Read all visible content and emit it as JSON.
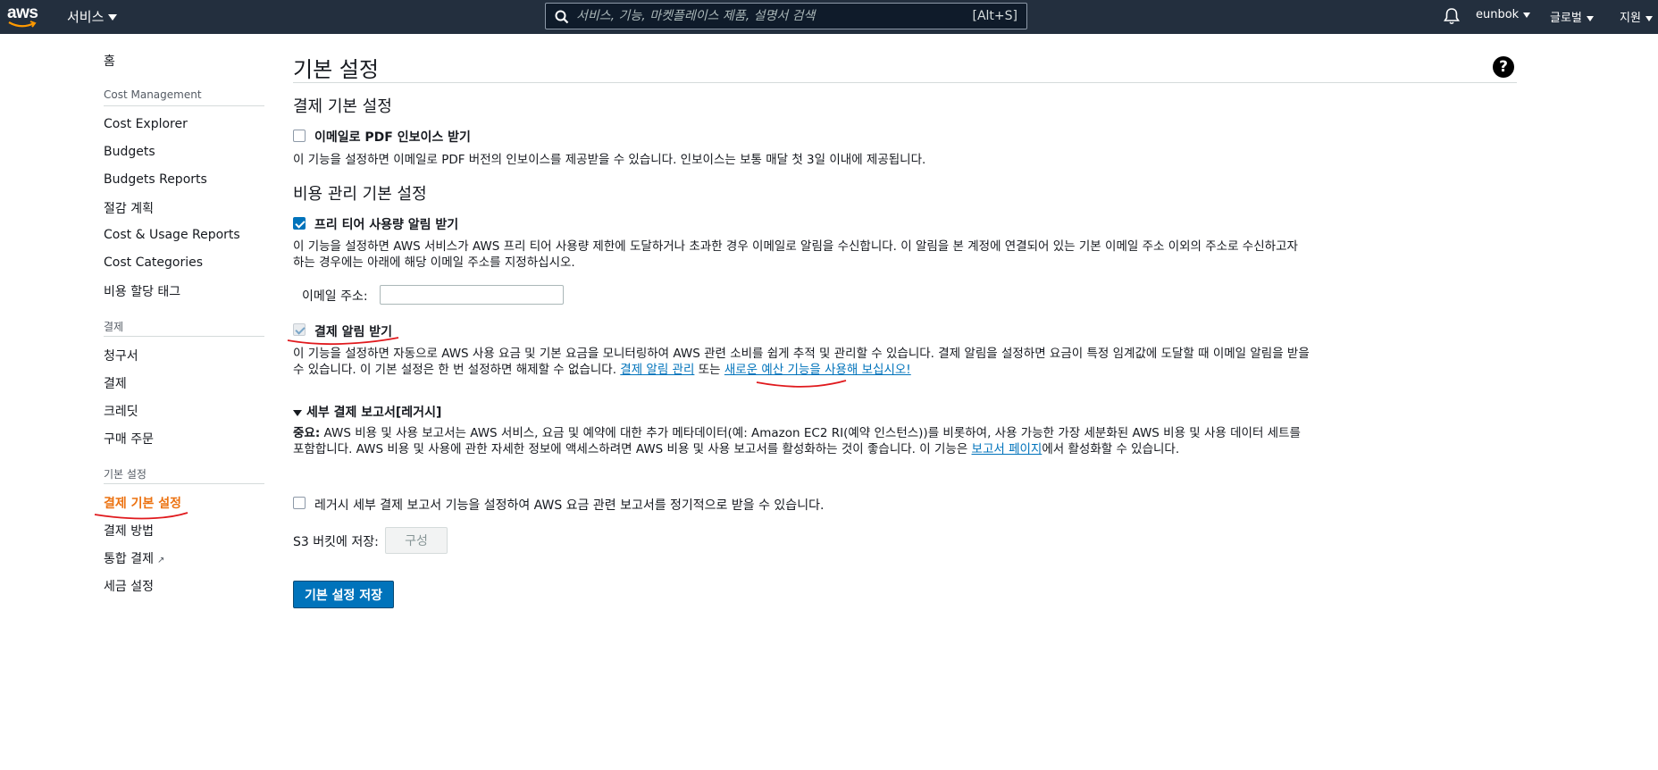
{
  "topnav": {
    "logo_text": "aws",
    "services_label": "서비스",
    "search_placeholder": "서비스, 기능, 마켓플레이스 제품, 설명서 검색",
    "search_shortcut": "[Alt+S]",
    "user_label": "eunbok",
    "region_label": "글로벌",
    "support_label": "지원"
  },
  "sidebar": {
    "home": "홈",
    "cost_management_heading": "Cost Management",
    "cost_management_items": [
      "Cost Explorer",
      "Budgets",
      "Budgets Reports",
      "절감 계획",
      "Cost & Usage Reports",
      "Cost Categories",
      "비용 할당 태그"
    ],
    "billing_heading": "결제",
    "billing_items": [
      "청구서",
      "결제",
      "크레딧",
      "구매 주문"
    ],
    "preferences_heading": "기본 설정",
    "preferences_items": [
      "결제 기본 설정",
      "결제 방법",
      "통합 결제",
      "세금 설정"
    ],
    "external_link_glyph": "↗"
  },
  "main": {
    "page_title": "기본 설정",
    "billing_section_title": "결제 기본 설정",
    "pdf_invoice_label": "이메일로 PDF 인보이스 받기",
    "pdf_invoice_desc": "이 기능을 설정하면 이메일로 PDF 버전의 인보이스를 제공받을 수 있습니다. 인보이스는 보통 매달 첫 3일 이내에 제공됩니다.",
    "cost_section_title": "비용 관리 기본 설정",
    "free_tier_label": "프리 티어 사용량 알림 받기",
    "free_tier_desc": "이 기능을 설정하면 AWS 서비스가 AWS 프리 티어 사용량 제한에 도달하거나 초과한 경우 이메일로 알림을 수신합니다. 이 알림을 본 계정에 연결되어 있는 기본 이메일 주소 이외의 주소로 수신하고자 하는 경우에는 아래에 해당 이메일 주소를 지정하십시오.",
    "email_label": "이메일 주소:",
    "email_value": "",
    "billing_alerts_label": "결제 알림 받기",
    "billing_alerts_desc": "이 기능을 설정하면 자동으로 AWS 사용 요금 및 기본 요금을 모니터링하여 AWS 관련 소비를 쉽게 추적 및 관리할 수 있습니다. 결제 알림을 설정하면 요금이 특정 임계값에 도달할 때 이메일 알림을 받을 수 있습니다. 이 기본 설정은 한 번 설정하면 해제할 수 없습니다.",
    "manage_alerts_link": "결제 알림 관리",
    "or_text": "또는",
    "new_budget_link": "새로운 예산 기능을 사용해 보십시오!",
    "detailed_reports_title": "세부 결제 보고서[레거시]",
    "important_label": "중요:",
    "detailed_reports_desc": "AWS 비용 및 사용 보고서는 AWS 서비스, 요금 및 예약에 대한 추가 메타데이터(예: Amazon EC2 RI(예약 인스턴스))를 비롯하여, 사용 가능한 가장 세분화된 AWS 비용 및 사용 데이터 세트를 포함합니다. AWS 비용 및 사용에 관한 자세한 정보에 액세스하려면 AWS 비용 및 사용 보고서를 활성화하는 것이 좋습니다. 이 기능은",
    "reports_page_link": "보고서 페이지",
    "detailed_reports_desc_end": "에서 활성화할 수 있습니다.",
    "legacy_label": "레거시 세부 결제 보고서 기능을 설정하여 AWS 요금 관련 보고서를 정기적으로 받을 수 있습니다.",
    "s3_label": "S3 버킷에 저장:",
    "configure_button": "구성",
    "save_button": "기본 설정 저장",
    "help_glyph": "?"
  },
  "colors": {
    "nav_bg": "#232f3e",
    "accent_orange": "#ec7211",
    "link_blue": "#0073bb",
    "annotation_red": "#e0191d"
  }
}
